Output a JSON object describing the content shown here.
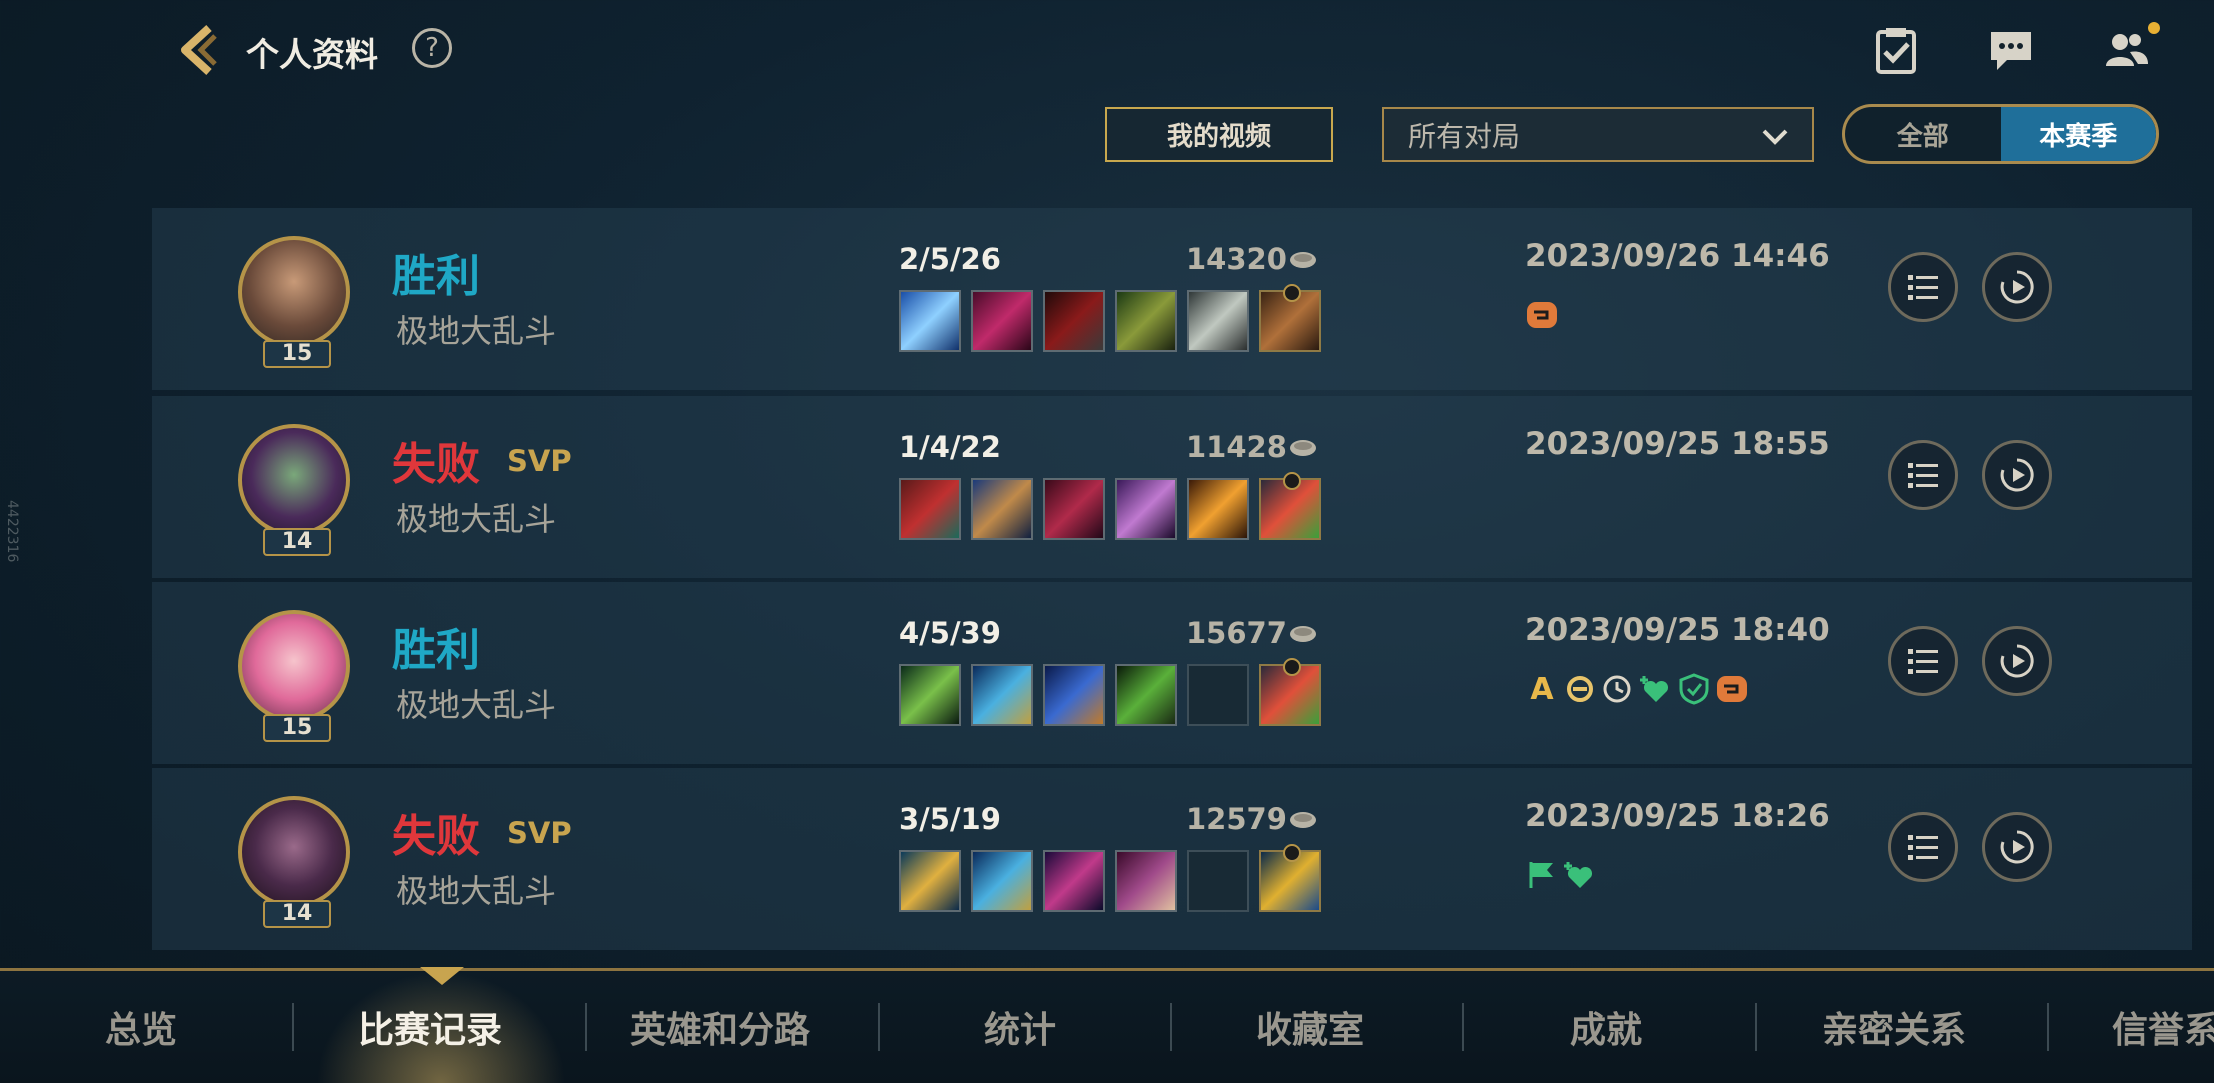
{
  "header": {
    "title": "个人资料",
    "help": "?",
    "icons": [
      "back-icon",
      "quest-icon",
      "chat-icon",
      "friends-icon"
    ]
  },
  "filters": {
    "video_button": "我的视频",
    "select_value": "所有对局",
    "segment": {
      "all": "全部",
      "season": "本赛季",
      "selected": "本赛季"
    }
  },
  "matches": [
    {
      "result": "胜利",
      "svp": "",
      "mode": "极地大乱斗",
      "level": "15",
      "kda": "2/5/26",
      "gold": "14320",
      "date": "2023/09/26 14:46"
    },
    {
      "result": "失败",
      "svp": "SVP",
      "mode": "极地大乱斗",
      "level": "14",
      "kda": "1/4/22",
      "gold": "11428",
      "date": "2023/09/25 18:55"
    },
    {
      "result": "胜利",
      "svp": "",
      "mode": "极地大乱斗",
      "level": "15",
      "kda": "4/5/39",
      "gold": "15677",
      "date": "2023/09/25 18:40"
    },
    {
      "result": "失败",
      "svp": "SVP",
      "mode": "极地大乱斗",
      "level": "14",
      "kda": "3/5/19",
      "gold": "12579",
      "date": "2023/09/25 18:26"
    }
  ],
  "badge_text": "A",
  "nav": {
    "items": [
      "总览",
      "比赛记录",
      "英雄和分路",
      "统计",
      "收藏室",
      "成就",
      "亲密关系",
      "信誉系"
    ],
    "active": "比赛记录"
  },
  "side_id": "4422316",
  "colors": {
    "win": "#1fa8c6",
    "lose": "#e0373b",
    "gold": "#c8a44f",
    "accent": "#1f6f9a"
  }
}
